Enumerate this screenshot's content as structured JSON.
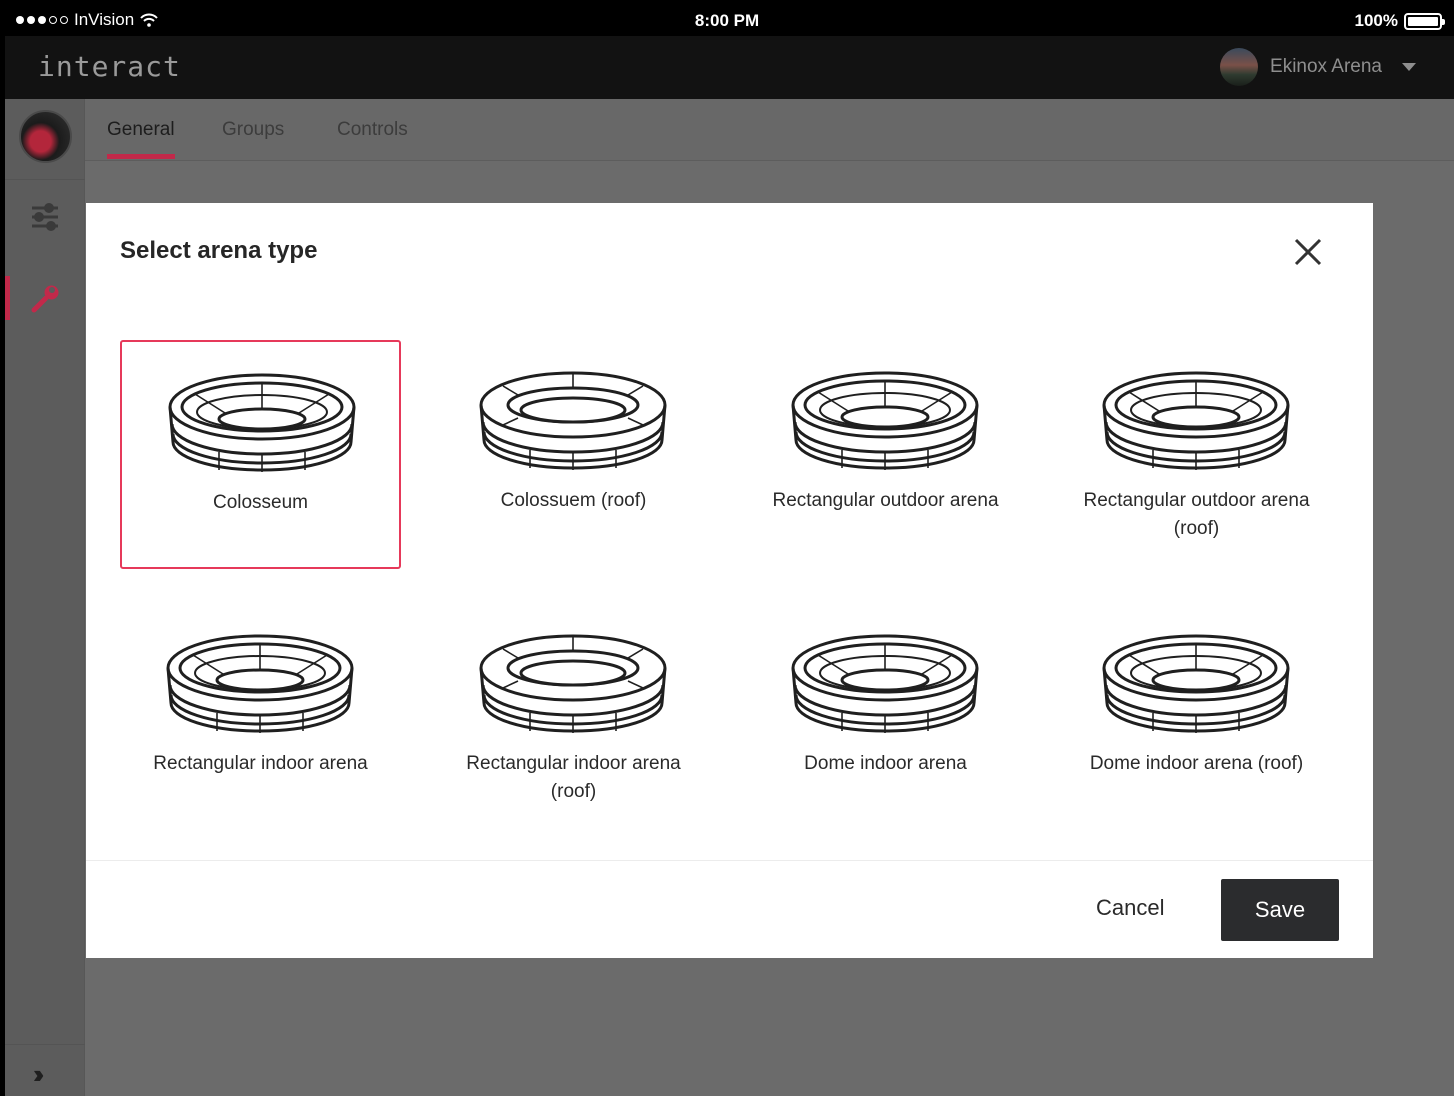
{
  "status_bar": {
    "carrier": "InVision",
    "time": "8:00 PM",
    "battery": "100%"
  },
  "header": {
    "logo": "interact",
    "venue_name": "Ekinox Arena"
  },
  "tabs": [
    {
      "label": "General",
      "active": true
    },
    {
      "label": "Groups",
      "active": false
    },
    {
      "label": "Controls",
      "active": false
    }
  ],
  "modal": {
    "title": "Select arena type",
    "options": [
      {
        "label": "Colosseum",
        "selected": true
      },
      {
        "label": "Colossuem (roof)",
        "selected": false
      },
      {
        "label": "Rectangular outdoor arena",
        "selected": false
      },
      {
        "label": "Rectangular outdoor arena (roof)",
        "selected": false
      },
      {
        "label": "Rectangular indoor arena",
        "selected": false
      },
      {
        "label": "Rectangular indoor arena (roof)",
        "selected": false
      },
      {
        "label": "Dome indoor arena",
        "selected": false
      },
      {
        "label": "Dome indoor arena (roof)",
        "selected": false
      }
    ],
    "cancel_label": "Cancel",
    "save_label": "Save"
  },
  "colors": {
    "accent": "#c2294a",
    "selected_border": "#e6395a",
    "save_button": "#2b2c2e"
  }
}
